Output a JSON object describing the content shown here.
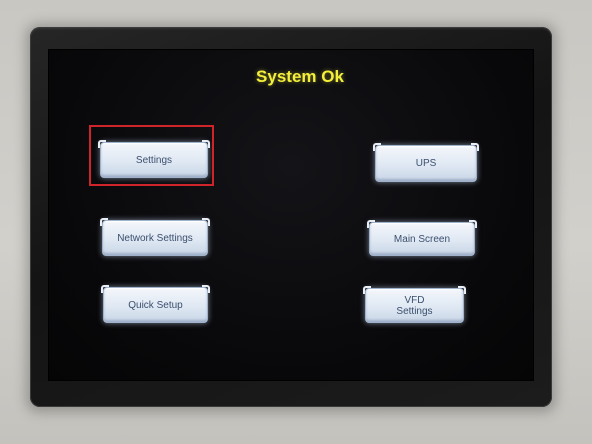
{
  "screen": {
    "status_title": "System Ok"
  },
  "buttons": {
    "settings": "Settings",
    "network_settings": "Network Settings",
    "quick_setup": "Quick Setup",
    "ups": "UPS",
    "main_screen": "Main Screen",
    "vfd_settings_line1": "VFD",
    "vfd_settings_line2": "Settings"
  },
  "colors": {
    "status_text": "#f3ef3a",
    "highlight": "#d0242b",
    "button_text": "#3b4f6e"
  }
}
